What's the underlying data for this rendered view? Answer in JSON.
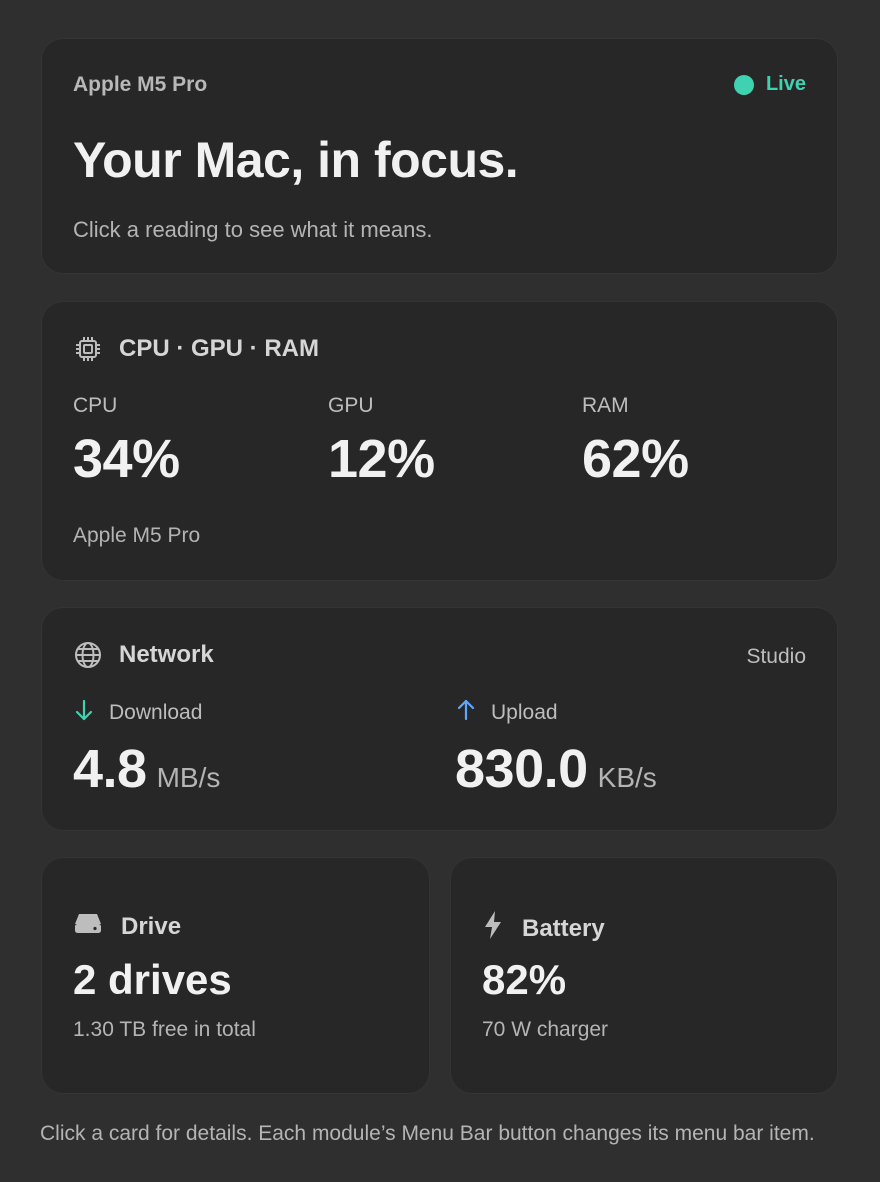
{
  "colors": {
    "live": "#3fd2b0",
    "download": "#3fd2b0",
    "upload": "#5ea7ff"
  },
  "hero": {
    "chip": "Apple M5 Pro",
    "live_label": "Live",
    "title": "Your Mac, in focus.",
    "subtitle": "Click a reading to see what it means."
  },
  "cpu_card": {
    "icon": "chip-icon",
    "title": "CPU · GPU · RAM",
    "metrics": [
      {
        "label": "CPU",
        "value": "34%"
      },
      {
        "label": "GPU",
        "value": "12%"
      },
      {
        "label": "RAM",
        "value": "62%"
      }
    ],
    "footer": "Apple M5 Pro"
  },
  "network_card": {
    "icon": "globe-icon",
    "title": "Network",
    "location": "Studio",
    "download": {
      "label": "Download",
      "value": "4.8",
      "unit": "MB/s",
      "icon": "arrow-down-icon"
    },
    "upload": {
      "label": "Upload",
      "value": "830.0",
      "unit": "KB/s",
      "icon": "arrow-up-icon"
    }
  },
  "drive_card": {
    "icon": "drive-icon",
    "title": "Drive",
    "value": "2 drives",
    "sub": "1.30 TB free in total"
  },
  "battery_card": {
    "icon": "bolt-icon",
    "title": "Battery",
    "value": "82%",
    "sub": "70 W charger"
  },
  "footer": "Click a card for details. Each module’s Menu Bar button changes its menu bar item."
}
